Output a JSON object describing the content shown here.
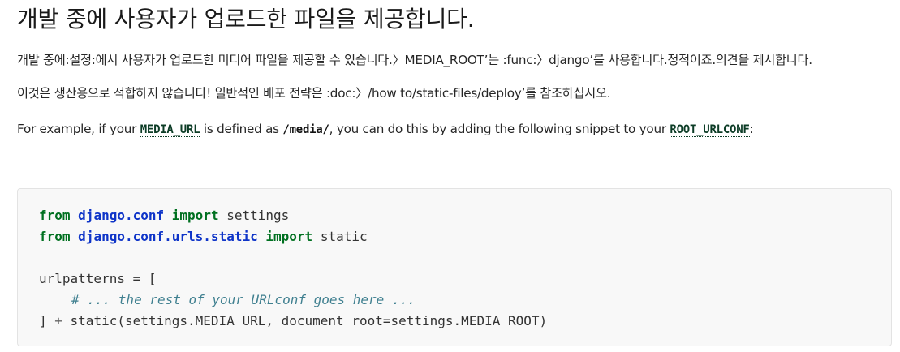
{
  "heading": "개발 중에 사용자가 업로드한 파일을 제공합니다.",
  "paragraph1": "개발 중에:설정:에서 사용자가 업로드한 미디어 파일을 제공할 수 있습니다.〉MEDIA_ROOT’는 :func:〉django’를 사용합니다.정적이죠.의견을 제시합니다.",
  "paragraph2": "이것은 생산용으로 적합하지 않습니다! 일반적인 배포 전략은 :doc:〉/how to/static-files/deploy’를 참조하십시오.",
  "paragraph3": {
    "part1": "For example, if your ",
    "code1": "MEDIA_URL",
    "part2": " is defined as ",
    "code2": "/media/",
    "part3": ", you can do this by adding the following snippet to your ",
    "code3": "ROOT_URLCONF",
    "part4": ":"
  },
  "code": {
    "line1": {
      "kw1": "from",
      "mod": "django.conf",
      "kw2": "import",
      "name": "settings"
    },
    "line2": {
      "kw1": "from",
      "mod": "django.conf.urls.static",
      "kw2": "import",
      "name": "static"
    },
    "line4": "urlpatterns = [",
    "line5": "# ... the rest of your URLconf goes here ...",
    "line6": {
      "open": "] ",
      "plus": "+",
      "rest": " static(settings.MEDIA_URL, document_root=settings.MEDIA_ROOT)"
    }
  }
}
